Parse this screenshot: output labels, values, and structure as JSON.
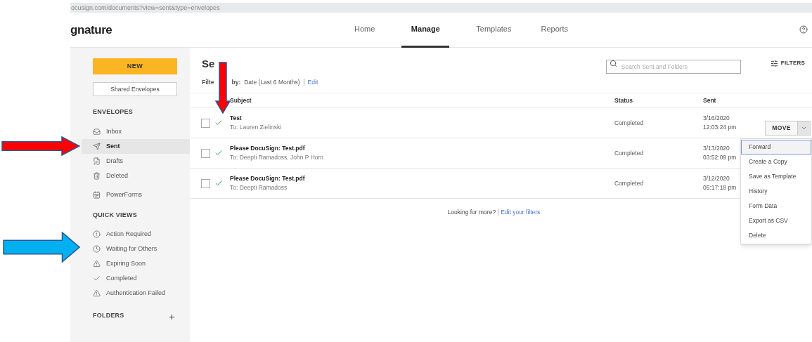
{
  "url": "ocusign.com/documents?view=sent&type=envelopes",
  "brand": "gnature",
  "nav": [
    {
      "label": "Home",
      "selected": false
    },
    {
      "label": "Manage",
      "selected": true
    },
    {
      "label": "Templates",
      "selected": false
    },
    {
      "label": "Reports",
      "selected": false
    }
  ],
  "sidebar": {
    "new_button": "NEW",
    "shared_button": "Shared Envelopes",
    "sections": [
      {
        "title": "ENVELOPES",
        "items": [
          {
            "label": "Inbox",
            "selected": false
          },
          {
            "label": "Sent",
            "selected": true
          },
          {
            "label": "Drafts",
            "selected": false
          },
          {
            "label": "Deleted",
            "selected": false
          },
          {
            "label": "PowerForms",
            "selected": false
          }
        ]
      },
      {
        "title": "QUICK VIEWS",
        "items": [
          {
            "label": "Action Required",
            "selected": false
          },
          {
            "label": "Waiting for Others",
            "selected": false
          },
          {
            "label": "Expiring Soon",
            "selected": false
          },
          {
            "label": "Completed",
            "selected": false
          },
          {
            "label": "Authentication Failed",
            "selected": false
          }
        ]
      }
    ],
    "folders_title": "FOLDERS"
  },
  "main": {
    "title": "Se",
    "filter_label": "Filte",
    "filter_by": "by:",
    "filter_value": "Date (Last 6 Months)",
    "edit_link": "Edit",
    "search": {
      "placeholder": "Search Sent and Folders"
    },
    "filters_button": "FILTERS",
    "columns": [
      "Subject",
      "Status",
      "Sent"
    ],
    "rows": [
      {
        "subject": "Test",
        "recipients": "To: Lauren Zielinski",
        "status": "Completed",
        "date": "3/16/2020",
        "time": "12:03:24 pm",
        "checked": false
      },
      {
        "subject": "Please DocuSign: Test.pdf",
        "recipients": "To: Deepti Ramadoss, John P Horn",
        "status": "Completed",
        "date": "3/13/2020",
        "time": "03:52:09 pm",
        "checked": false
      },
      {
        "subject": "Please DocuSign: Test.pdf",
        "recipients": "To: Deepti Ramadoss",
        "status": "Completed",
        "date": "3/12/2020",
        "time": "05:17:18 pm",
        "checked": false
      }
    ],
    "move_button": "MOVE",
    "menu": [
      {
        "label": "Forward",
        "selected": true
      },
      {
        "label": "Create a Copy",
        "selected": false
      },
      {
        "label": "Save as Template",
        "selected": false
      },
      {
        "label": "History",
        "selected": false
      },
      {
        "label": "Form Data",
        "selected": false
      },
      {
        "label": "Export as CSV",
        "selected": false
      },
      {
        "label": "Delete",
        "selected": false
      }
    ],
    "footer": "Looking for more?",
    "footer_link": "Edit your filters"
  },
  "annotations": [
    {
      "kind": "down",
      "color": "#ff0000"
    },
    {
      "kind": "right",
      "color": "#ff0000"
    },
    {
      "kind": "right",
      "color": "#00b0f0"
    }
  ]
}
